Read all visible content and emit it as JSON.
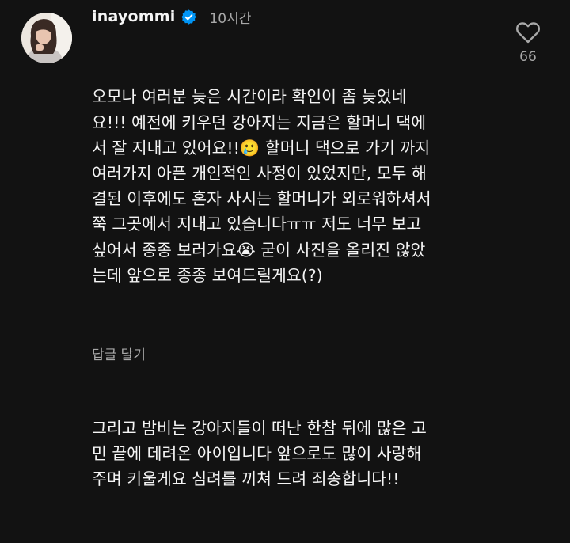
{
  "comment": {
    "username": "inayommi",
    "timestamp": "10시간",
    "body_part1": "오모나 여러분 늦은 시간이라 확인이 좀 늦었네\n요!!! 예전에 키우던 강아지는 지금은 할머니 댁에\n서 잘 지내고 있어요!!🥲 할머니 댁으로 가기 까지\n여러가지 아픈 개인적인 사정이 있었지만, 모두 해\n결된 이후에도 혼자 사시는 할머니가 외로워하셔서\n쭉 그곳에서 지내고 있습니다ㅠㅠ 저도 너무 보고\n싶어서 종종 보러가요😭 굳이 사진을 올리진 않았\n는데 앞으로 종종 보여드릴게요(?)",
    "body_part2": "그리고 밤비는 강아지들이 떠난 한참 뒤에 많은 고\n민 끝에 데려온 아이입니다 앞으로도 많이 사랑해\n주며 키울게요 심려를 끼쳐 드려 죄송합니다!!",
    "reply_label": "답글 달기",
    "like_count": "66",
    "icons": {
      "verified": "verified-badge-icon",
      "like": "heart-outline-icon"
    },
    "colors": {
      "background": "#121212",
      "text": "#f5f5f5",
      "secondary_text": "#a8a8a8",
      "verified_blue": "#0095f6"
    }
  }
}
